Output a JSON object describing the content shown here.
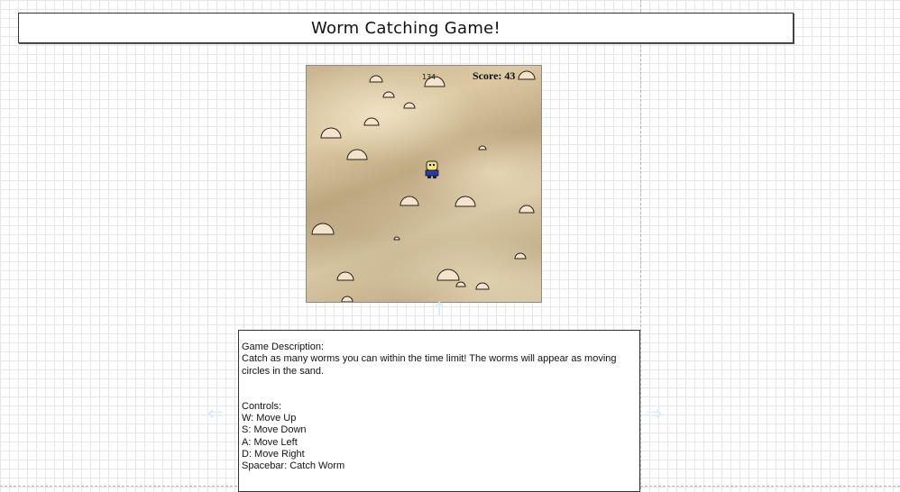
{
  "header": {
    "title": "Worm Catching Game!"
  },
  "game": {
    "timer": "134",
    "score_label": "Score: 43",
    "colors": {
      "mound_fill": "#f4e4cb",
      "mound_stroke": "#2a1f14",
      "player_shirt": "#2a3bb0",
      "player_head": "#f0e08a"
    },
    "mounds": [
      [
        77,
        18,
        7
      ],
      [
        91,
        35,
        6
      ],
      [
        142,
        23,
        11
      ],
      [
        114,
        47,
        6
      ],
      [
        72,
        66,
        8
      ],
      [
        27,
        80,
        11
      ],
      [
        56,
        104,
        11
      ],
      [
        195,
        93,
        4
      ],
      [
        114,
        155,
        10
      ],
      [
        176,
        156,
        11
      ],
      [
        244,
        163,
        8
      ],
      [
        18,
        187,
        12
      ],
      [
        100,
        193,
        3
      ],
      [
        237,
        214,
        6
      ],
      [
        43,
        238,
        9
      ],
      [
        157,
        238,
        12
      ],
      [
        171,
        245,
        5
      ],
      [
        195,
        248,
        7
      ],
      [
        45,
        262,
        6
      ],
      [
        244,
        15,
        9
      ]
    ]
  },
  "description": {
    "heading": "Game Description:",
    "text": "Catch as many worms you can within the time limit! The worms will appear as moving circles in the sand.",
    "controls_heading": "Controls:",
    "controls": [
      "W: Move Up",
      "S: Move Down",
      "A: Move Left",
      "D: Move Right",
      "Spacebar: Catch Worm"
    ]
  }
}
